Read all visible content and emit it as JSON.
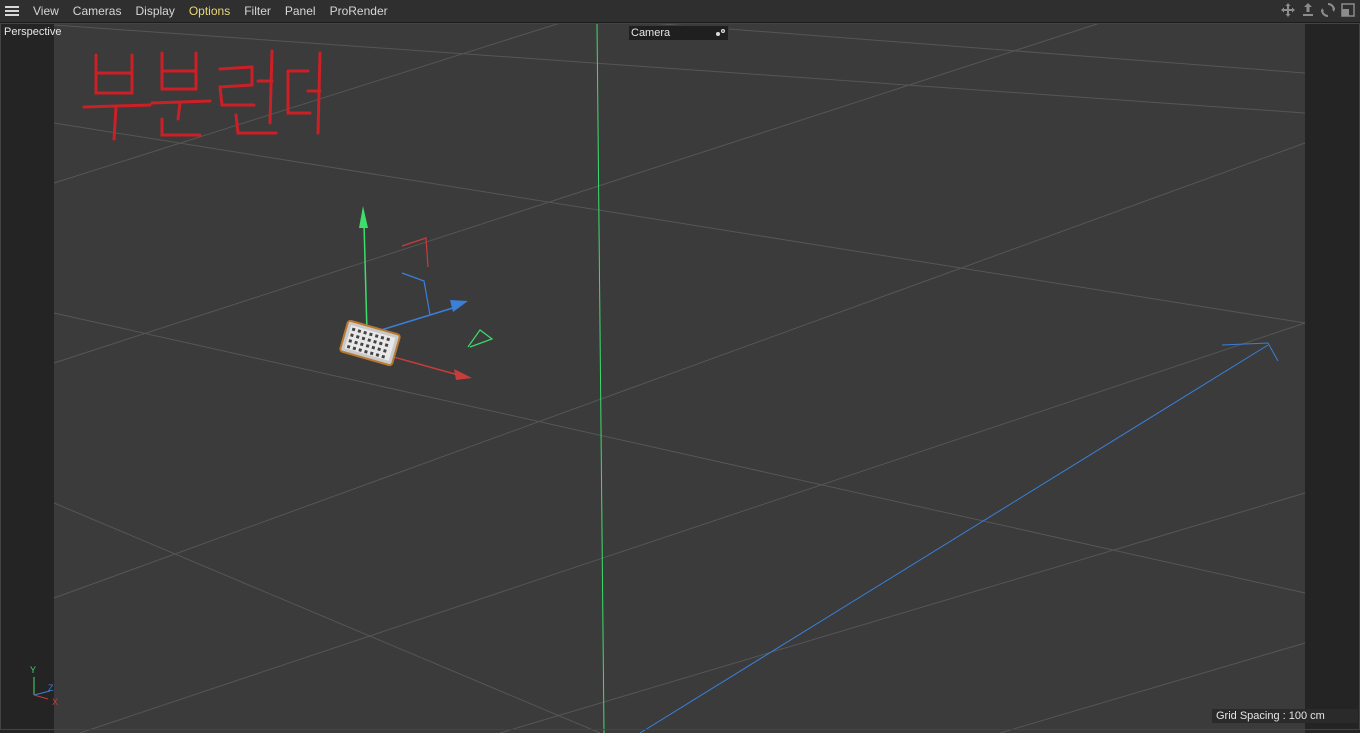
{
  "menubar": {
    "items": [
      {
        "label": "View",
        "active": false
      },
      {
        "label": "Cameras",
        "active": false
      },
      {
        "label": "Display",
        "active": false
      },
      {
        "label": "Options",
        "active": true
      },
      {
        "label": "Filter",
        "active": false
      },
      {
        "label": "Panel",
        "active": false
      },
      {
        "label": "ProRender",
        "active": false
      }
    ],
    "nav_icons": [
      "move-view-icon",
      "dolly-view-icon",
      "rotate-view-icon",
      "maximize-view-icon"
    ]
  },
  "viewport": {
    "view_name": "Perspective",
    "camera": {
      "label": "Camera",
      "icon": "camera-options-icon"
    },
    "grid_spacing": "Grid Spacing : 100 cm",
    "axis_gizmo": {
      "y": "Y",
      "z": "Z",
      "x": "X"
    },
    "annotation_text": "부분렌더"
  },
  "colors": {
    "accent_active_menu": "#e8d67a",
    "axis_x": "#c83c3c",
    "axis_y": "#3ddc6c",
    "axis_z": "#3a7fd8",
    "annotation": "#cc1f26"
  }
}
